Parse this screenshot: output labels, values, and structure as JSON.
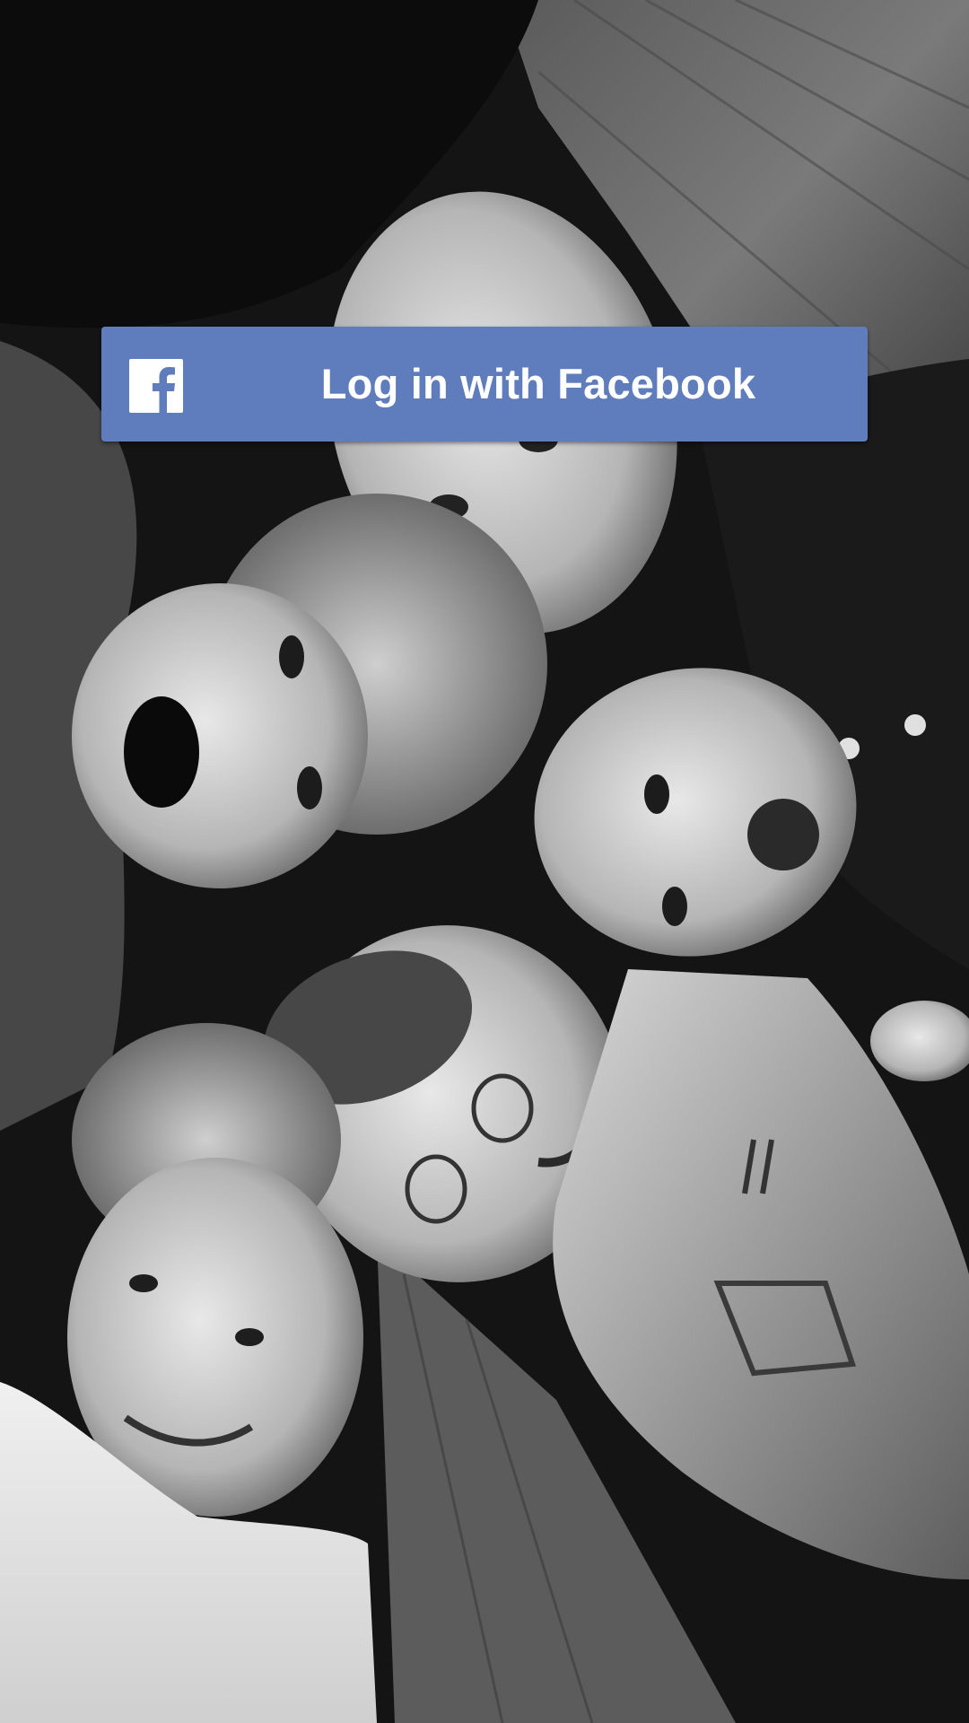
{
  "login": {
    "button_label": "Log in with Facebook",
    "button_color": "#5f7dbd",
    "icon": "facebook-logo-icon"
  },
  "background": {
    "description_color_scheme": "grayscale"
  }
}
